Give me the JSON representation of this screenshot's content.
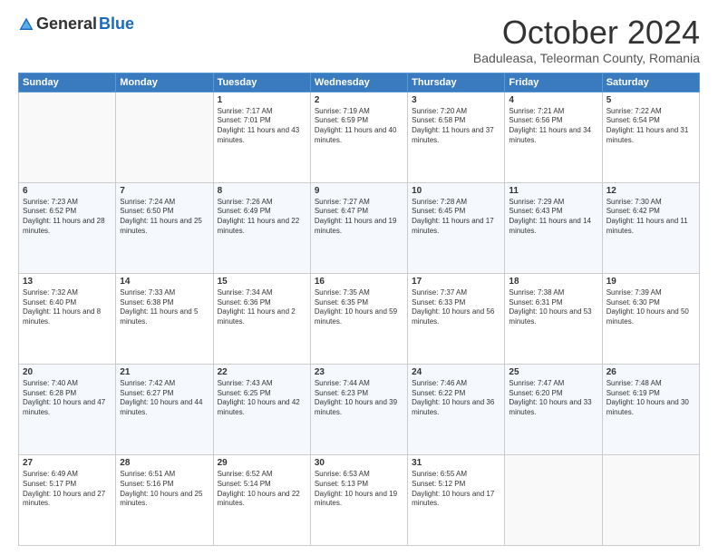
{
  "logo": {
    "general": "General",
    "blue": "Blue"
  },
  "header": {
    "month": "October 2024",
    "location": "Baduleasa, Teleorman County, Romania"
  },
  "weekdays": [
    "Sunday",
    "Monday",
    "Tuesday",
    "Wednesday",
    "Thursday",
    "Friday",
    "Saturday"
  ],
  "weeks": [
    [
      {
        "day": "",
        "content": ""
      },
      {
        "day": "",
        "content": ""
      },
      {
        "day": "1",
        "content": "Sunrise: 7:17 AM\nSunset: 7:01 PM\nDaylight: 11 hours and 43 minutes."
      },
      {
        "day": "2",
        "content": "Sunrise: 7:19 AM\nSunset: 6:59 PM\nDaylight: 11 hours and 40 minutes."
      },
      {
        "day": "3",
        "content": "Sunrise: 7:20 AM\nSunset: 6:58 PM\nDaylight: 11 hours and 37 minutes."
      },
      {
        "day": "4",
        "content": "Sunrise: 7:21 AM\nSunset: 6:56 PM\nDaylight: 11 hours and 34 minutes."
      },
      {
        "day": "5",
        "content": "Sunrise: 7:22 AM\nSunset: 6:54 PM\nDaylight: 11 hours and 31 minutes."
      }
    ],
    [
      {
        "day": "6",
        "content": "Sunrise: 7:23 AM\nSunset: 6:52 PM\nDaylight: 11 hours and 28 minutes."
      },
      {
        "day": "7",
        "content": "Sunrise: 7:24 AM\nSunset: 6:50 PM\nDaylight: 11 hours and 25 minutes."
      },
      {
        "day": "8",
        "content": "Sunrise: 7:26 AM\nSunset: 6:49 PM\nDaylight: 11 hours and 22 minutes."
      },
      {
        "day": "9",
        "content": "Sunrise: 7:27 AM\nSunset: 6:47 PM\nDaylight: 11 hours and 19 minutes."
      },
      {
        "day": "10",
        "content": "Sunrise: 7:28 AM\nSunset: 6:45 PM\nDaylight: 11 hours and 17 minutes."
      },
      {
        "day": "11",
        "content": "Sunrise: 7:29 AM\nSunset: 6:43 PM\nDaylight: 11 hours and 14 minutes."
      },
      {
        "day": "12",
        "content": "Sunrise: 7:30 AM\nSunset: 6:42 PM\nDaylight: 11 hours and 11 minutes."
      }
    ],
    [
      {
        "day": "13",
        "content": "Sunrise: 7:32 AM\nSunset: 6:40 PM\nDaylight: 11 hours and 8 minutes."
      },
      {
        "day": "14",
        "content": "Sunrise: 7:33 AM\nSunset: 6:38 PM\nDaylight: 11 hours and 5 minutes."
      },
      {
        "day": "15",
        "content": "Sunrise: 7:34 AM\nSunset: 6:36 PM\nDaylight: 11 hours and 2 minutes."
      },
      {
        "day": "16",
        "content": "Sunrise: 7:35 AM\nSunset: 6:35 PM\nDaylight: 10 hours and 59 minutes."
      },
      {
        "day": "17",
        "content": "Sunrise: 7:37 AM\nSunset: 6:33 PM\nDaylight: 10 hours and 56 minutes."
      },
      {
        "day": "18",
        "content": "Sunrise: 7:38 AM\nSunset: 6:31 PM\nDaylight: 10 hours and 53 minutes."
      },
      {
        "day": "19",
        "content": "Sunrise: 7:39 AM\nSunset: 6:30 PM\nDaylight: 10 hours and 50 minutes."
      }
    ],
    [
      {
        "day": "20",
        "content": "Sunrise: 7:40 AM\nSunset: 6:28 PM\nDaylight: 10 hours and 47 minutes."
      },
      {
        "day": "21",
        "content": "Sunrise: 7:42 AM\nSunset: 6:27 PM\nDaylight: 10 hours and 44 minutes."
      },
      {
        "day": "22",
        "content": "Sunrise: 7:43 AM\nSunset: 6:25 PM\nDaylight: 10 hours and 42 minutes."
      },
      {
        "day": "23",
        "content": "Sunrise: 7:44 AM\nSunset: 6:23 PM\nDaylight: 10 hours and 39 minutes."
      },
      {
        "day": "24",
        "content": "Sunrise: 7:46 AM\nSunset: 6:22 PM\nDaylight: 10 hours and 36 minutes."
      },
      {
        "day": "25",
        "content": "Sunrise: 7:47 AM\nSunset: 6:20 PM\nDaylight: 10 hours and 33 minutes."
      },
      {
        "day": "26",
        "content": "Sunrise: 7:48 AM\nSunset: 6:19 PM\nDaylight: 10 hours and 30 minutes."
      }
    ],
    [
      {
        "day": "27",
        "content": "Sunrise: 6:49 AM\nSunset: 5:17 PM\nDaylight: 10 hours and 27 minutes."
      },
      {
        "day": "28",
        "content": "Sunrise: 6:51 AM\nSunset: 5:16 PM\nDaylight: 10 hours and 25 minutes."
      },
      {
        "day": "29",
        "content": "Sunrise: 6:52 AM\nSunset: 5:14 PM\nDaylight: 10 hours and 22 minutes."
      },
      {
        "day": "30",
        "content": "Sunrise: 6:53 AM\nSunset: 5:13 PM\nDaylight: 10 hours and 19 minutes."
      },
      {
        "day": "31",
        "content": "Sunrise: 6:55 AM\nSunset: 5:12 PM\nDaylight: 10 hours and 17 minutes."
      },
      {
        "day": "",
        "content": ""
      },
      {
        "day": "",
        "content": ""
      }
    ]
  ]
}
